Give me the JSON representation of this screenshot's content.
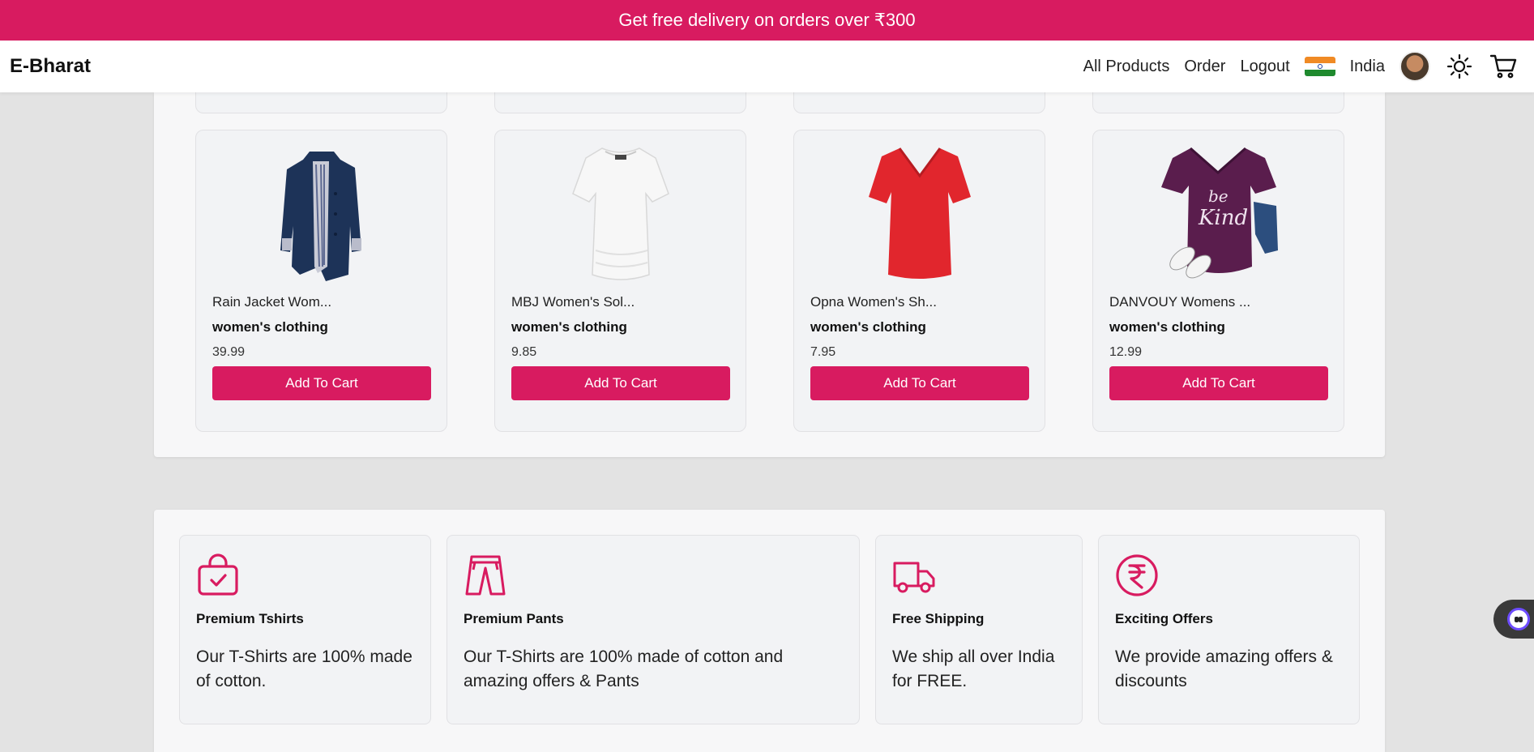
{
  "promo_banner": {
    "text": "Get free delivery on orders over ₹300"
  },
  "nav": {
    "logo": "E-Bharat",
    "links": [
      "All Products",
      "Order",
      "Logout"
    ],
    "country": "India",
    "icons": [
      "india-flag-icon",
      "avatar",
      "sun-icon",
      "cart-icon"
    ]
  },
  "products": [
    {
      "title": "Rain Jacket Wom...",
      "category": "women's clothing",
      "price": "39.99",
      "button": "Add To Cart",
      "image": "navy-rain-jacket"
    },
    {
      "title": "MBJ Women's Sol...",
      "category": "women's clothing",
      "price": "9.85",
      "button": "Add To Cart",
      "image": "white-tshirt"
    },
    {
      "title": "Opna Women's Sh...",
      "category": "women's clothing",
      "price": "7.95",
      "button": "Add To Cart",
      "image": "red-vneck-tshirt"
    },
    {
      "title": "DANVOUY Womens ...",
      "category": "women's clothing",
      "price": "12.99",
      "button": "Add To Cart",
      "image": "purple-be-kind-tshirt"
    }
  ],
  "product_image_text": {
    "be": "be",
    "kind": "Kind"
  },
  "features": [
    {
      "icon": "shopping-bag-check-icon",
      "title": "Premium Tshirts",
      "description": "Our T-Shirts are 100% made of cotton."
    },
    {
      "icon": "pants-icon",
      "title": "Premium Pants",
      "description": "Our T-Shirts are 100% made of cotton and amazing offers & Pants"
    },
    {
      "icon": "truck-icon",
      "title": "Free Shipping",
      "description": "We ship all over India for FREE."
    },
    {
      "icon": "rupee-icon",
      "title": "Exciting Offers",
      "description": "We provide amazing offers & discounts"
    }
  ],
  "colors": {
    "accent": "#d81b60",
    "background": "#e3e3e3",
    "card": "#f2f3f5"
  }
}
